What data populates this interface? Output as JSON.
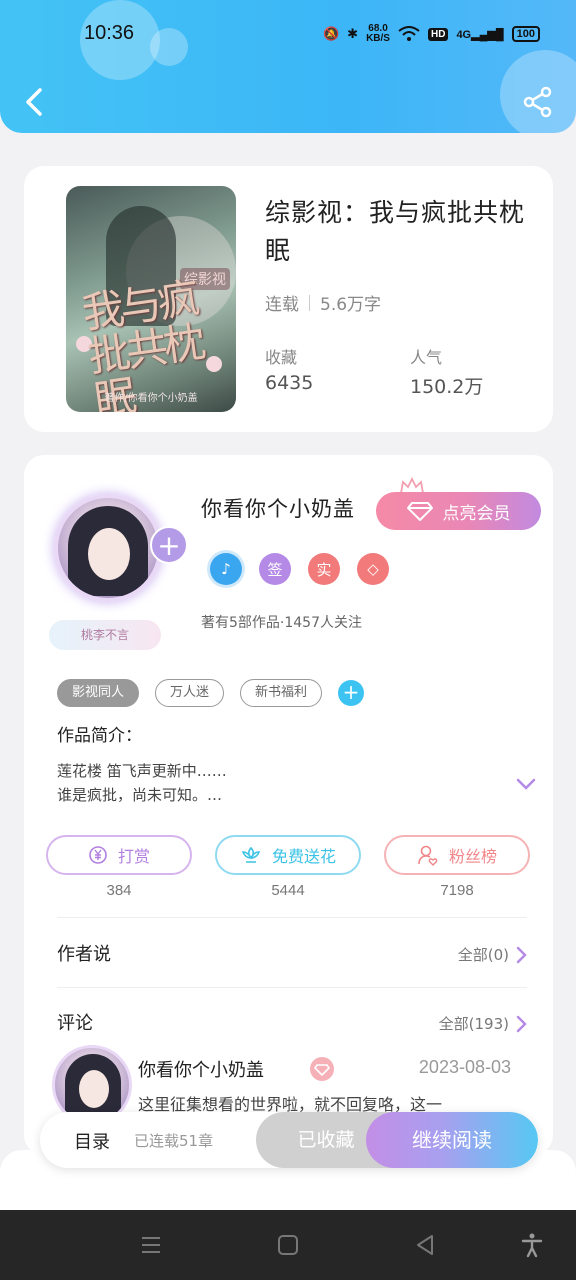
{
  "status_bar": {
    "time": "10:36",
    "speed_value": "68.0",
    "speed_unit": "KB/S",
    "hd": "HD",
    "network": "4G",
    "battery": "100"
  },
  "header": {
    "back_icon": "back-chevron-icon",
    "share_icon": "share-icon"
  },
  "book": {
    "title": "综影视：我与疯批共枕眠",
    "status": "连载",
    "word_count": "5.6万字",
    "favorites_label": "收藏",
    "favorites_value": "6435",
    "popularity_label": "人气",
    "popularity_value": "150.2万",
    "cover": {
      "art_title": "我与疯批共枕眠",
      "art_tag": "综影视",
      "art_author": "著作/你看你个小奶盖"
    }
  },
  "author": {
    "name": "你看你个小奶盖",
    "vip_button": "点亮会员",
    "avatar_tag": "桃李不言",
    "badges": [
      {
        "icon": "music-note-icon",
        "text": "♪",
        "color": "#3aa6f0"
      },
      {
        "icon": "sign-badge-icon",
        "text": "签",
        "color": "#b48ae6"
      },
      {
        "icon": "verified-badge-icon",
        "text": "实",
        "color": "#f27a7a"
      },
      {
        "icon": "diamond-badge-icon",
        "text": "◇",
        "color": "#f27a7a"
      }
    ],
    "stats": "著有5部作品·1457人关注"
  },
  "tags": [
    "影视同人",
    "万人迷",
    "新书福利"
  ],
  "intro": {
    "title": "作品简介：",
    "line1": "莲花楼 笛飞声更新中……",
    "line2": "谁是疯批，尚未可知。…"
  },
  "actions": [
    {
      "label": "打赏",
      "count": "384",
      "icon": "yen-coin-icon",
      "color": "#b27fe0"
    },
    {
      "label": "免费送花",
      "count": "5444",
      "icon": "flower-icon",
      "color": "#3cc3e6"
    },
    {
      "label": "粉丝榜",
      "count": "7198",
      "icon": "fan-ranking-icon",
      "color": "#f2868a"
    }
  ],
  "author_says": {
    "title": "作者说",
    "link": "全部(0)"
  },
  "comments": {
    "title": "评论",
    "link": "全部(193)",
    "first": {
      "name": "你看你个小奶盖",
      "date": "2023-08-03",
      "text": "这里征集想看的世界啦，就不回复咯，这一"
    }
  },
  "bottom_bar": {
    "toc": "目录",
    "toc_sub": "已连载51章",
    "collected": "已收藏",
    "continue": "继续阅读"
  },
  "colors": {
    "header": "#43c3f5",
    "accent_blue": "#3cc3f2",
    "accent_purple": "#b48ae6",
    "vip_pink": "#f58aa6"
  }
}
